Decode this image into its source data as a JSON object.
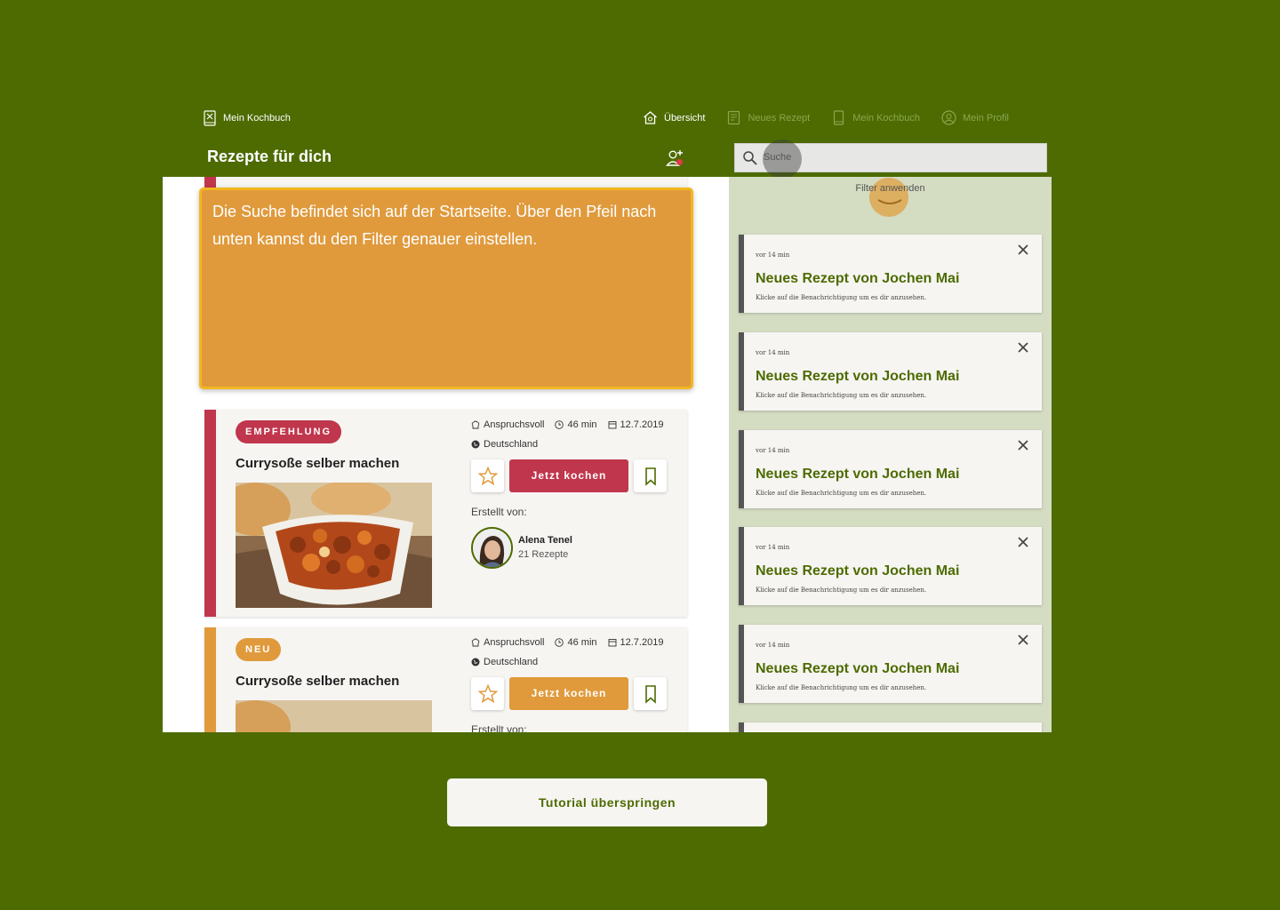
{
  "nav": {
    "brand": "Mein Kochbuch",
    "links": [
      {
        "label": "Übersicht",
        "icon": "home-icon",
        "active": true
      },
      {
        "label": "Neues Rezept",
        "icon": "document-icon",
        "active": false
      },
      {
        "label": "Mein Kochbuch",
        "icon": "book-icon",
        "active": false
      },
      {
        "label": "Mein Profil",
        "icon": "profile-icon",
        "active": false
      }
    ]
  },
  "header": {
    "title": "Rezepte für dich",
    "search_placeholder": "Suche"
  },
  "filter": {
    "label": "Filter anwenden"
  },
  "tutorial": {
    "text": "Die Suche befindet sich auf der Startseite. Über den Pfeil nach unten kannst du den Filter genauer einstellen.",
    "skip_label": "Tutorial überspringen"
  },
  "notifications": [
    {
      "time": "vor 14 min",
      "title": "Neues Rezept von Jochen Mai",
      "sub": "Klicke auf die Benachrichtigung um es dir anzusehen."
    },
    {
      "time": "vor 14 min",
      "title": "Neues Rezept von Jochen Mai",
      "sub": "Klicke auf die Benachrichtigung um es dir anzusehen."
    },
    {
      "time": "vor 14 min",
      "title": "Neues Rezept von Jochen Mai",
      "sub": "Klicke auf die Benachrichtigung um es dir anzusehen."
    },
    {
      "time": "vor 14 min",
      "title": "Neues Rezept von Jochen Mai",
      "sub": "Klicke auf die Benachrichtigung um es dir anzusehen."
    },
    {
      "time": "vor 14 min",
      "title": "Neues Rezept von Jochen Mai",
      "sub": "Klicke auf die Benachrichtigung um es dir anzusehen."
    }
  ],
  "recipes": [
    {
      "badge": "EMPFEHLUNG",
      "title": "Currysoße selber machen",
      "difficulty": "Anspruchsvoll",
      "duration": "46 min",
      "date": "12.7.2019",
      "country": "Deutschland",
      "cook_label": "Jetzt kochen",
      "created_by": "Erstellt von:",
      "author": "Alena Tenel",
      "author_count": "21 Rezepte",
      "accent": "#c0364c"
    },
    {
      "badge": "NEU",
      "title": "Currysoße selber machen",
      "difficulty": "Anspruchsvoll",
      "duration": "46 min",
      "date": "12.7.2019",
      "country": "Deutschland",
      "cook_label": "Jetzt kochen",
      "created_by": "Erstellt von:",
      "accent": "#e09a3c"
    }
  ],
  "colors": {
    "background": "#4d6b00",
    "sidebar": "#d4dcc2",
    "recommend": "#c0364c",
    "new": "#e09a3c"
  }
}
